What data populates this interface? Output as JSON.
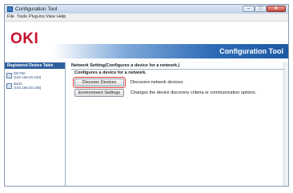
{
  "window": {
    "title": "Configuration Tool",
    "close_label": "✕",
    "min_label": "–",
    "max_label": "□"
  },
  "menu": [
    "File",
    "Tools",
    "Plug-ins",
    "View",
    "Help"
  ],
  "header": {
    "logo": "OKI",
    "banner_title": "Configuration Tool"
  },
  "sidebar": {
    "heading": "Registered Device Table",
    "devices": [
      {
        "name": "MC760",
        "address": "(192.168.20.233)"
      },
      {
        "name": "B431",
        "address": "(192.168.20.108)"
      }
    ]
  },
  "main": {
    "breadcrumb": "Network Setting(Configures a device for a network.)",
    "section_title": "Configures a device for a network.",
    "discover_button": "Discover Devices",
    "discover_desc": "Discovers network devices.",
    "env_button": "Environment Settings",
    "env_desc": "Changes the device discovery criteria or communication options."
  },
  "colors": {
    "brand_red": "#c8102e",
    "banner_blue": "#1e5aa4",
    "highlight": "#e03a3a"
  }
}
